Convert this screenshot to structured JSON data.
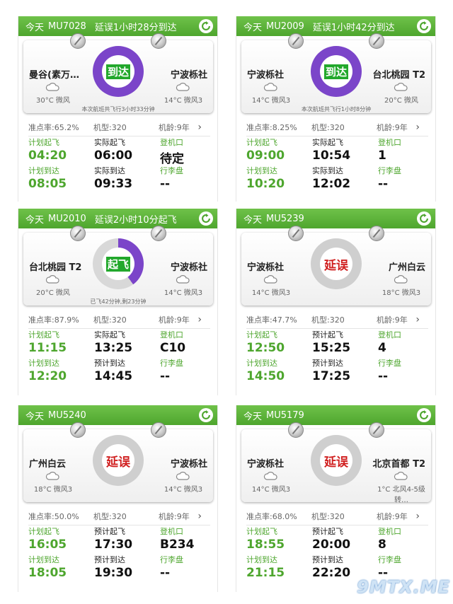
{
  "cards": [
    {
      "day": "今天",
      "flight": "MU7028",
      "status_line": "延误1小时28分到达",
      "status": "到达",
      "dep_city": "曼谷(素万…",
      "dep_weather": "30°C 微风",
      "arr_city": "宁波栎社",
      "arr_weather": "14°C 微风3",
      "note": "本次航班共飞行3小时33分钟",
      "ontime": "准点率:65.2%",
      "model": "机型:320",
      "age": "机龄:9年",
      "sched_dep_label": "计划起飞",
      "sched_dep": "04:20",
      "act_dep_label": "实际起飞",
      "act_dep": "06:00",
      "gate_label": "登机口",
      "gate": "待定",
      "sched_arr_label": "计划到达",
      "sched_arr": "08:05",
      "act_arr_label": "实际到达",
      "act_arr": "09:33",
      "bag_label": "行李盘",
      "bag": "--"
    },
    {
      "day": "今天",
      "flight": "MU2009",
      "status_line": "延误1小时42分到达",
      "status": "到达",
      "dep_city": "宁波栎社",
      "dep_weather": "14°C 微风3",
      "arr_city": "台北桃园 T2",
      "arr_weather": "20°C 微风",
      "note": "本次航班共飞行1小时8分钟",
      "ontime": "准点率:8.25%",
      "model": "机型:320",
      "age": "机龄:9年",
      "sched_dep_label": "计划起飞",
      "sched_dep": "09:00",
      "act_dep_label": "实际起飞",
      "act_dep": "10:54",
      "gate_label": "登机口",
      "gate": "1",
      "sched_arr_label": "计划到达",
      "sched_arr": "10:20",
      "act_arr_label": "实际到达",
      "act_arr": "12:02",
      "bag_label": "行李盘",
      "bag": "--"
    },
    {
      "day": "今天",
      "flight": "MU2010",
      "status_line": "延误2小时10分起飞",
      "status": "起飞",
      "dep_city": "台北桃园 T2",
      "dep_weather": "20°C 微风",
      "arr_city": "宁波栎社",
      "arr_weather": "14°C 微风3",
      "note": "已飞42分钟,剩23分钟",
      "ontime": "准点率:87.9%",
      "model": "机型:320",
      "age": "机龄:9年",
      "sched_dep_label": "计划起飞",
      "sched_dep": "11:15",
      "act_dep_label": "实际起飞",
      "act_dep": "13:25",
      "gate_label": "登机口",
      "gate": "C10",
      "sched_arr_label": "计划到达",
      "sched_arr": "12:20",
      "act_arr_label": "预计到达",
      "act_arr": "14:45",
      "bag_label": "行李盘",
      "bag": "--"
    },
    {
      "day": "今天",
      "flight": "MU5239",
      "status_line": "",
      "status": "延误",
      "dep_city": "宁波栎社",
      "dep_weather": "14°C 微风3",
      "arr_city": "广州白云",
      "arr_weather": "18°C 微风3",
      "note": "",
      "ontime": "准点率:47.7%",
      "model": "机型:320",
      "age": "机龄:9年",
      "sched_dep_label": "计划起飞",
      "sched_dep": "12:50",
      "act_dep_label": "预计起飞",
      "act_dep": "15:25",
      "gate_label": "登机口",
      "gate": "4",
      "sched_arr_label": "计划到达",
      "sched_arr": "14:50",
      "act_arr_label": "预计到达",
      "act_arr": "17:25",
      "bag_label": "行李盘",
      "bag": "--"
    },
    {
      "day": "今天",
      "flight": "MU5240",
      "status_line": "",
      "status": "延误",
      "dep_city": "广州白云",
      "dep_weather": "18°C 微风3",
      "arr_city": "宁波栎社",
      "arr_weather": "14°C 微风3",
      "note": "",
      "ontime": "准点率:50.0%",
      "model": "机型:320",
      "age": "机龄:9年",
      "sched_dep_label": "计划起飞",
      "sched_dep": "16:05",
      "act_dep_label": "预计起飞",
      "act_dep": "17:30",
      "gate_label": "登机口",
      "gate": "B234",
      "sched_arr_label": "计划到达",
      "sched_arr": "18:05",
      "act_arr_label": "预计到达",
      "act_arr": "19:30",
      "bag_label": "行李盘",
      "bag": "--"
    },
    {
      "day": "今天",
      "flight": "MU5179",
      "status_line": "",
      "status": "延误",
      "dep_city": "宁波栎社",
      "dep_weather": "14°C 微风3",
      "arr_city": "北京首都 T2",
      "arr_weather": "1°C 北风4-5级转…",
      "note": "",
      "ontime": "准点率:68.0%",
      "model": "机型:320",
      "age": "机龄:9年",
      "sched_dep_label": "计划起飞",
      "sched_dep": "18:55",
      "act_dep_label": "预计起飞",
      "act_dep": "20:00",
      "gate_label": "登机口",
      "gate": "8",
      "sched_arr_label": "计划到达",
      "sched_arr": "21:15",
      "act_arr_label": "预计到达",
      "act_arr": "22:20",
      "bag_label": "行李盘",
      "bag": "--"
    }
  ],
  "watermark": "9MTX.ME",
  "colors": {
    "header_green": "#4ea62e",
    "ring_purple": "#7b45c9",
    "delay_red": "#d01f1f"
  }
}
